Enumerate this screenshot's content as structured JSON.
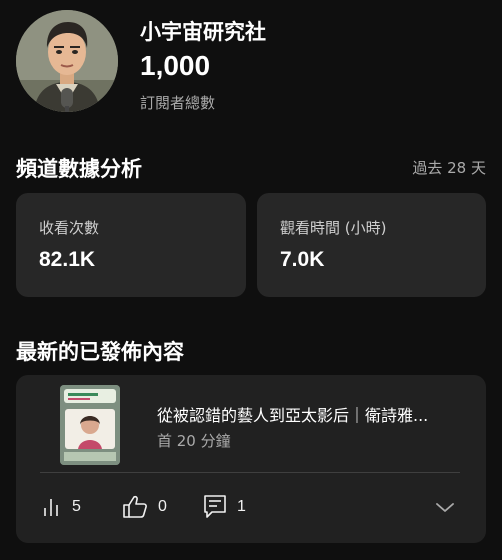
{
  "channel": {
    "name": "小宇宙研究社",
    "subscriber_count": "1,000",
    "subscriber_label": "訂閱者總數",
    "avatar_icon": "avatar-illustration"
  },
  "analytics": {
    "title": "頻道數據分析",
    "period": "過去 28 天",
    "metrics": [
      {
        "label": "收看次數",
        "value": "82.1K"
      },
      {
        "label": "觀看時間 (小時)",
        "value": "7.0K"
      }
    ]
  },
  "latest_content": {
    "title": "最新的已發佈內容",
    "video": {
      "title": "從被認錯的藝人到亞太影后｜衛詩雅...",
      "meta": "首 20 分鐘",
      "views": "5",
      "likes": "0",
      "comments": "1",
      "icons": {
        "views": "bar-chart-icon",
        "likes": "thumbs-up-icon",
        "comments": "comment-icon",
        "expand": "chevron-down-icon"
      }
    }
  },
  "colors": {
    "background": "#0f0f0f",
    "card": "#272727",
    "content_card": "#212121",
    "text_primary": "#ffffff",
    "text_secondary": "#aaaaaa"
  }
}
